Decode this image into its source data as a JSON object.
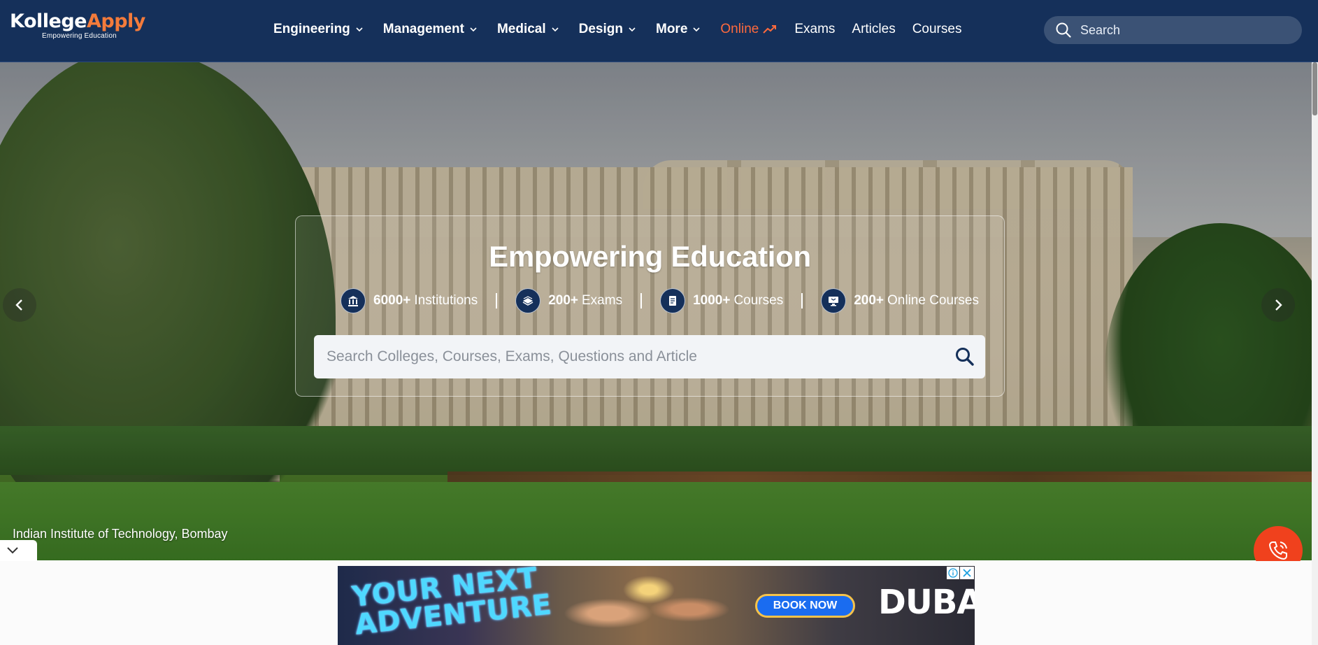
{
  "header": {
    "logo": {
      "part1": "Kollege",
      "part2": "Apply",
      "tagline": "Empowering Education"
    },
    "nav": [
      {
        "label": "Engineering"
      },
      {
        "label": "Management"
      },
      {
        "label": "Medical"
      },
      {
        "label": "Design"
      },
      {
        "label": "More"
      }
    ],
    "nav_plain": {
      "online": "Online",
      "exams": "Exams",
      "articles": "Articles",
      "courses": "Courses"
    },
    "search_placeholder": "Search"
  },
  "hero": {
    "title": "Empowering Education",
    "stats": [
      {
        "value": "6000+",
        "label": "Institutions",
        "icon": "institution-icon"
      },
      {
        "value": "200+",
        "label": "Exams",
        "icon": "book-stack-icon"
      },
      {
        "value": "1000+",
        "label": "Courses",
        "icon": "document-icon"
      },
      {
        "value": "200+",
        "label": "Online Courses",
        "icon": "monitor-icon"
      }
    ],
    "search_placeholder": "Search Colleges, Courses, Exams, Questions and Article",
    "caption": "Indian Institute of Technology, Bombay"
  },
  "ad": {
    "headline_line1": "YOUR NEXT",
    "headline_line2": "ADVENTURE",
    "cta": "BOOK NOW",
    "brand": "DUBAI"
  },
  "colors": {
    "header_bg": "#15305a",
    "accent_orange": "#f47b3b",
    "online_red": "#ff6a3d",
    "call_button": "#f0411d"
  }
}
